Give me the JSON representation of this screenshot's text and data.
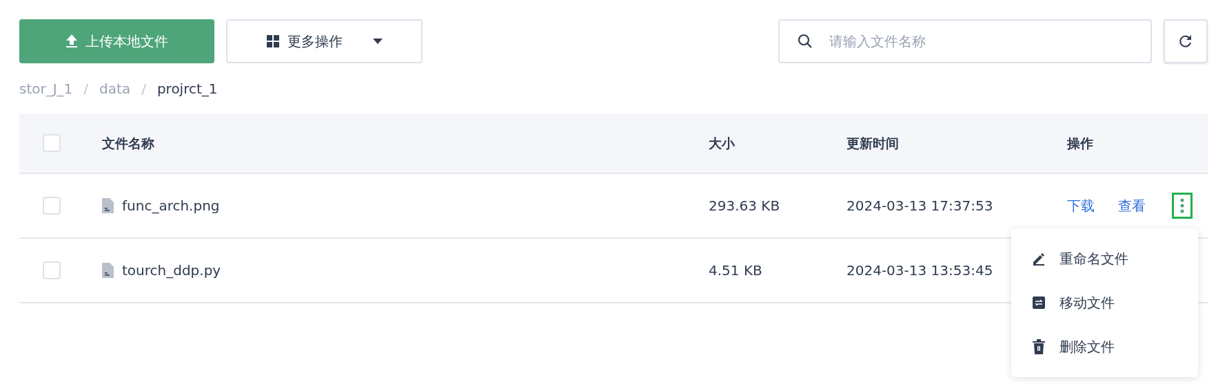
{
  "toolbar": {
    "upload_button": "上传本地文件",
    "more_button": "更多操作",
    "search": {
      "placeholder": "请输入文件名称"
    }
  },
  "breadcrumb": [
    {
      "label": "stor_J_1",
      "current": false
    },
    {
      "label": "data",
      "current": false
    },
    {
      "label": "projrct_1",
      "current": true
    }
  ],
  "breadcrumb_separator": "/",
  "table": {
    "select_all_checked": false,
    "columns": [
      "文件名称",
      "大小",
      "更新时间",
      "操作"
    ],
    "rows": [
      {
        "checked": false,
        "name": "func_arch.png",
        "size": "293.63 KB",
        "updated": "2024-03-13 17:37:53",
        "actions": [
          "下载",
          "查看"
        ],
        "menu_open": true
      },
      {
        "checked": false,
        "name": "tourch_ddp.py",
        "size": "4.51 KB",
        "updated": "2024-03-13 13:53:45",
        "actions": []
      }
    ]
  },
  "context_menu": [
    {
      "kind": "rename",
      "label": "重命名文件"
    },
    {
      "kind": "move",
      "label": "移动文件"
    },
    {
      "kind": "delete",
      "label": "删除文件"
    }
  ]
}
